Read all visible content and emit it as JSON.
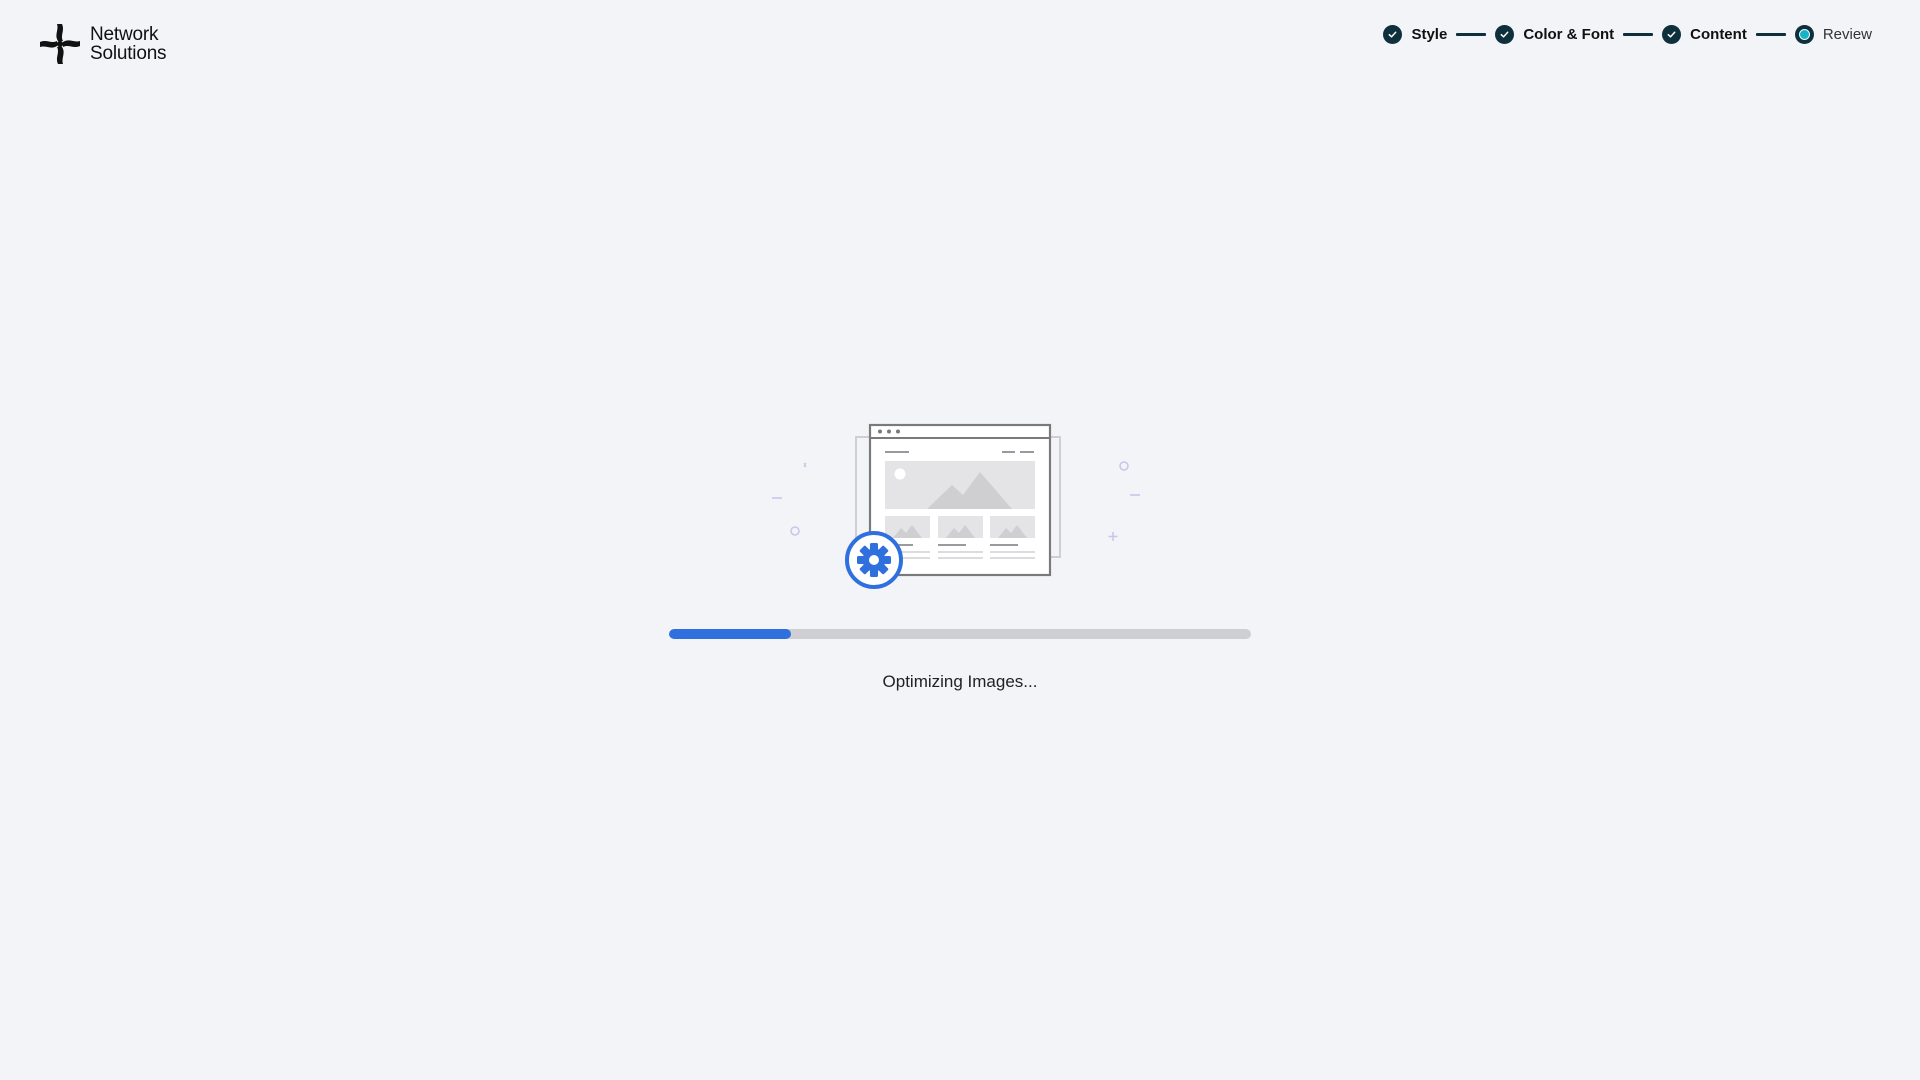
{
  "brand": {
    "line1": "Network",
    "line2": "Solutions"
  },
  "stepper": {
    "steps": [
      {
        "label": "Style",
        "state": "complete"
      },
      {
        "label": "Color & Font",
        "state": "complete"
      },
      {
        "label": "Content",
        "state": "complete"
      },
      {
        "label": "Review",
        "state": "current"
      }
    ]
  },
  "loading": {
    "progress_percent": 21,
    "status_text": "Optimizing Images..."
  },
  "colors": {
    "accent": "#2f6fde",
    "step_complete": "#0e2f3c",
    "step_current": "#19b3c9",
    "background": "#f3f4f8"
  },
  "icons": {
    "logo": "network-solutions-logo-icon",
    "check": "check-icon",
    "gear": "gear-icon"
  }
}
